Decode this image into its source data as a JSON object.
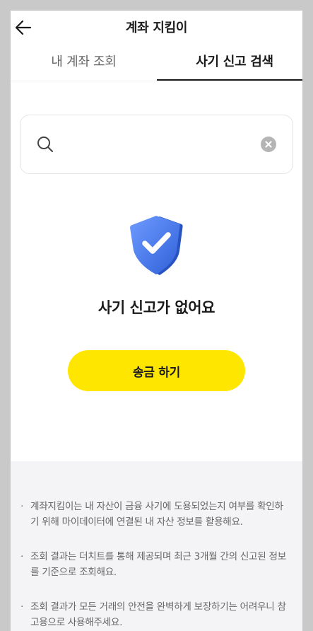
{
  "header": {
    "title": "계좌 지킴이",
    "back_icon": "arrow-left-icon"
  },
  "tabs": [
    {
      "label": "내 계좌 조회",
      "selected": false
    },
    {
      "label": "사기 신고 검색",
      "selected": true
    }
  ],
  "search": {
    "icon": "search-icon",
    "value": "",
    "clear_icon": "clear-icon"
  },
  "result": {
    "icon": "shield-check-icon",
    "message": "사기 신고가 없어요"
  },
  "actions": {
    "send_label": "송금 하기"
  },
  "notice": [
    "계좌지킴이는 내 자산이 금융 사기에 도용되었는지 여부를 확인하기 위해 마이데이터에 연결된 내 자산 정보를 활용해요.",
    "조회 결과는 더치트를 통해 제공되며 최근 3개월 간의 신고된 정보를 기준으로 조회해요.",
    "조회 결과가 모든 거래의 안전을 완벽하게 보장하기는 어려우니 참고용으로 사용해주세요."
  ],
  "colors": {
    "accent": "#ffe600",
    "shield": "#4a7ff0",
    "background": "#c9c9c9"
  }
}
